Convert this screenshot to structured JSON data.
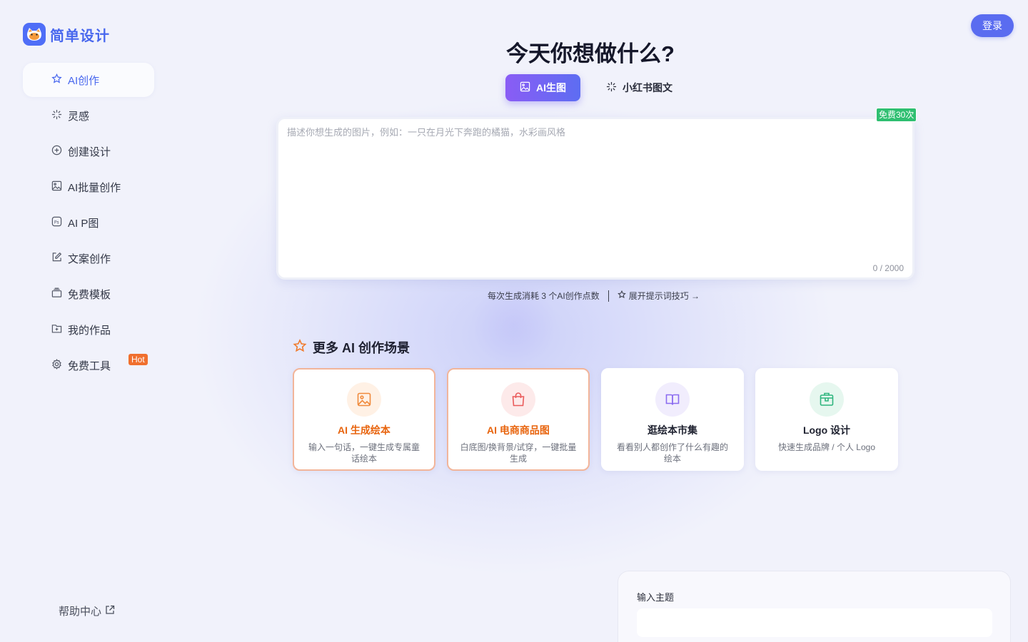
{
  "brand": {
    "name": "简单设计",
    "accent": "#4867ee"
  },
  "header": {
    "login_label": "登录"
  },
  "sidebar": {
    "items": [
      {
        "label": "AI创作",
        "icon": "star-icon",
        "active": true
      },
      {
        "label": "灵感",
        "icon": "sparkle-icon"
      },
      {
        "label": "创建设计",
        "icon": "plus-circle-icon"
      },
      {
        "label": "AI批量创作",
        "icon": "image-icon"
      },
      {
        "label": "AI P图",
        "icon": "ps-icon"
      },
      {
        "label": "文案创作",
        "icon": "edit-icon"
      },
      {
        "label": "免费模板",
        "icon": "template-icon"
      },
      {
        "label": "我的作品",
        "icon": "folder-icon"
      },
      {
        "label": "免费工具",
        "icon": "gear-icon",
        "badge": "Hot"
      }
    ],
    "help_label": "帮助中心"
  },
  "main": {
    "title": "今天你想做什么?",
    "tabs": [
      {
        "label": "AI生图",
        "active": true
      },
      {
        "label": "小红书图文"
      }
    ],
    "prompt": {
      "placeholder": "描述你想生成的图片，例如：一只在月光下奔跑的橘猫，水彩画风格",
      "value": "",
      "counter": "0 / 2000",
      "free_badge": "免费30次"
    },
    "hint": {
      "cost": "每次生成消耗 3 个AI创作点数",
      "tips": "展开提示词技巧 →"
    },
    "scenes": {
      "title": "更多 AI 创作场景",
      "cards": [
        {
          "title": "AI 生成绘本",
          "desc": "输入一句话，一键生成专属童话绘本",
          "title_color": "#e8650f",
          "icon": "picture-icon",
          "icon_color": "#f08a3c",
          "icon_bg": "#fff1e5"
        },
        {
          "title": "AI 电商商品图",
          "desc": "白底图/换背景/试穿，一键批量生成",
          "title_color": "#e8650f",
          "icon": "shopping-bag-icon",
          "icon_color": "#ea5b5b",
          "icon_bg": "#fdeaea"
        },
        {
          "title": "逛绘本市集",
          "desc": "看看别人都创作了什么有趣的绘本",
          "title_color": "#1e2030",
          "icon": "book-icon",
          "icon_color": "#8b6cf0",
          "icon_bg": "#f1edfd"
        },
        {
          "title": "Logo 设计",
          "desc": "快速生成品牌 / 个人 Logo",
          "title_color": "#1e2030",
          "icon": "box-icon",
          "icon_color": "#2fb57e",
          "icon_bg": "#e6f7ef"
        }
      ]
    }
  },
  "topic_panel": {
    "label": "输入主题"
  }
}
